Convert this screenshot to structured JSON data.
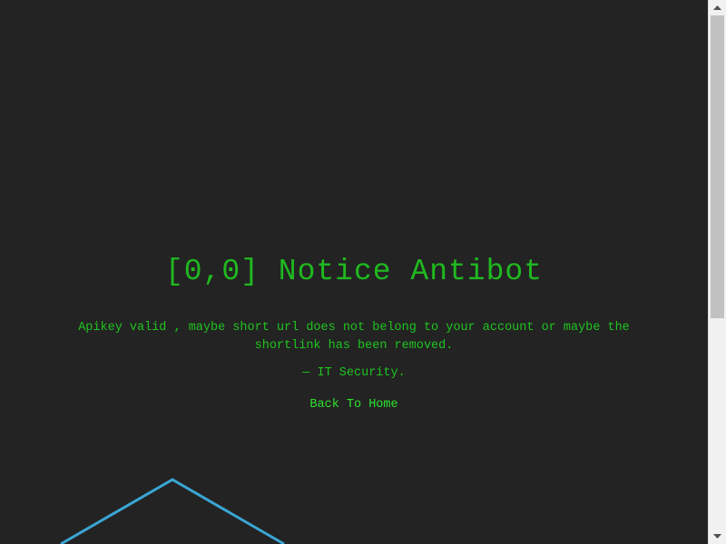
{
  "page": {
    "title": "[0,0] Notice Antibot",
    "message": "Apikey valid , maybe short url does not belong to your account or maybe the shortlink has been removed.",
    "signature": "— IT Security.",
    "back_link_label": "Back To Home"
  },
  "colors": {
    "background": "#232323",
    "title_text": "#1fb91f",
    "body_text": "#1fc41f",
    "link_text": "#2de32d",
    "decor_line": "#3aa6d4"
  },
  "scrollbar": {
    "up_icon": "arrow-up-icon",
    "down_icon": "arrow-down-icon"
  }
}
